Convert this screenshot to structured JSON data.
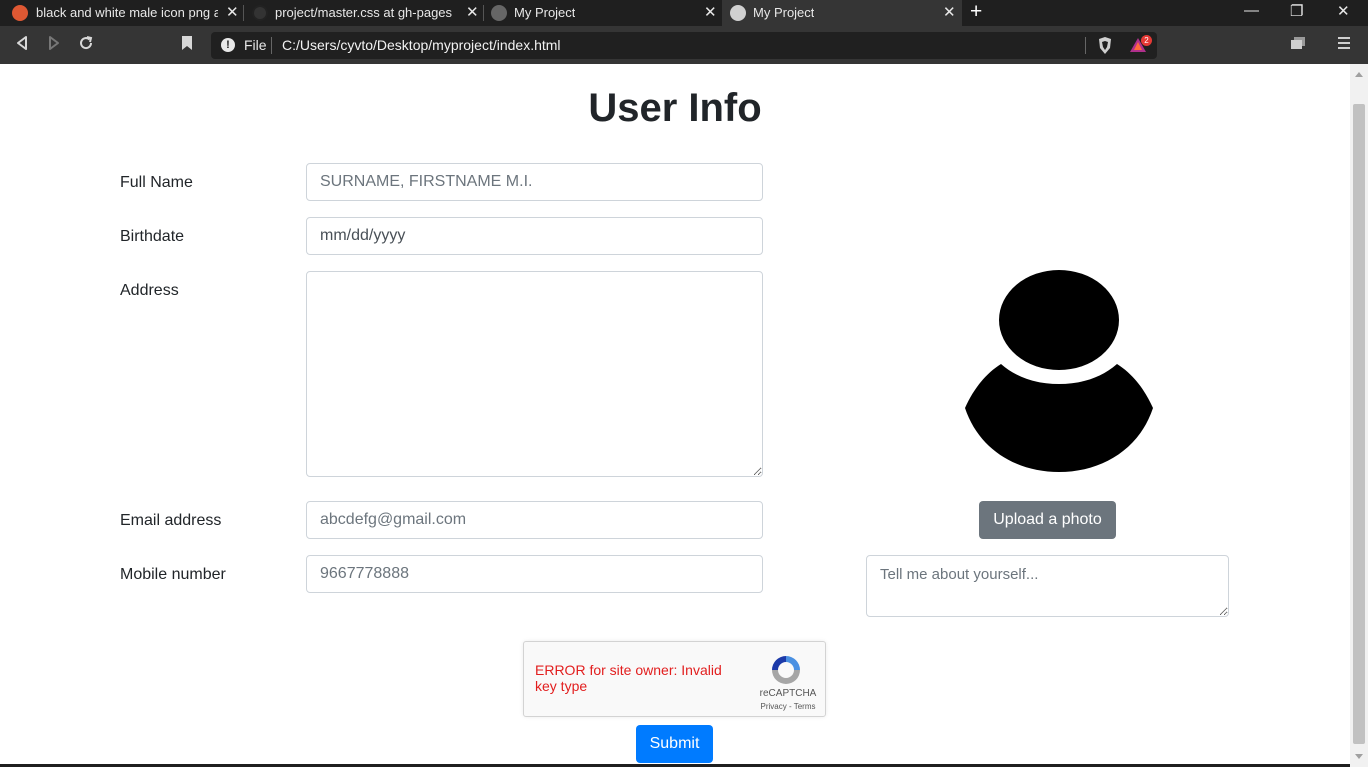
{
  "tabs": [
    {
      "title": "black and white male icon png at D",
      "icon": "duckduckgo-icon"
    },
    {
      "title": "project/master.css at gh-pages · cy",
      "icon": "github-icon"
    },
    {
      "title": "My Project",
      "icon": "globe-icon"
    },
    {
      "title": "My Project",
      "icon": "globe-icon"
    }
  ],
  "toolbar": {
    "scheme": "File",
    "url": "C:/Users/cyvto/Desktop/myproject/index.html",
    "rewards_badge": "2"
  },
  "page": {
    "title": "User Info",
    "fields": {
      "full_name": {
        "label": "Full Name",
        "placeholder": "SURNAME, FIRSTNAME M.I."
      },
      "birthdate": {
        "label": "Birthdate",
        "value": "mm/dd/yyyy"
      },
      "address": {
        "label": "Address",
        "value": ""
      },
      "email": {
        "label": "Email address",
        "placeholder": "abcdefg@gmail.com"
      },
      "mobile": {
        "label": "Mobile number",
        "placeholder": "9667778888"
      }
    },
    "upload_label": "Upload a photo",
    "about_placeholder": "Tell me about yourself...",
    "recaptcha": {
      "error": "ERROR for site owner: Invalid key type",
      "brand": "reCAPTCHA",
      "links": "Privacy - Terms"
    },
    "submit_label": "Submit"
  },
  "colors": {
    "primary": "#007bff",
    "secondary": "#6c757d",
    "error": "#e21e1e"
  }
}
